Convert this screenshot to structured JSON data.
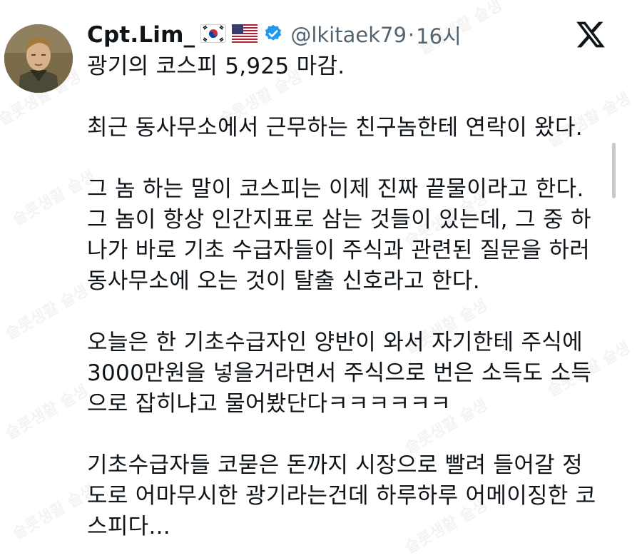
{
  "author": {
    "display_name": "Cpt.Lim_",
    "flags": [
      "kr-flag-icon",
      "us-flag-icon"
    ],
    "verified_icon": "verified-badge-icon",
    "handle": "@lkitaek79",
    "separator": "·",
    "time": "16시"
  },
  "platform_icon": "x-logo-icon",
  "tweet": {
    "paragraphs": [
      "광기의 코스피 5,925 마감.",
      "최근 동사무소에서 근무하는 친구놈한테 연락이 왔다.",
      "그 놈 하는 말이 코스피는 이제 진짜 끝물이라고 한다.\n그 놈이 항상 인간지표로 삼는 것들이 있는데, 그 중 하\n나가 바로 기초 수급자들이 주식과 관련된 질문을 하러\n동사무소에 오는 것이 탈출 신호라고 한다.",
      "오늘은 한 기초수급자인 양반이 와서 자기한테 주식에\n3000만원을 넣을거라면서 주식으로 번은 소득도 소득\n으로 잡히냐고 물어봤단다ㅋㅋㅋㅋㅋㅋ",
      "기초수급자들 코묻은 돈까지 시장으로 빨려 들어갈 정\n도로 어마무시한 광기라는건데 하루하루 어메이징한 코\n스피다..."
    ]
  },
  "watermark": "슬롯생활 슬생"
}
